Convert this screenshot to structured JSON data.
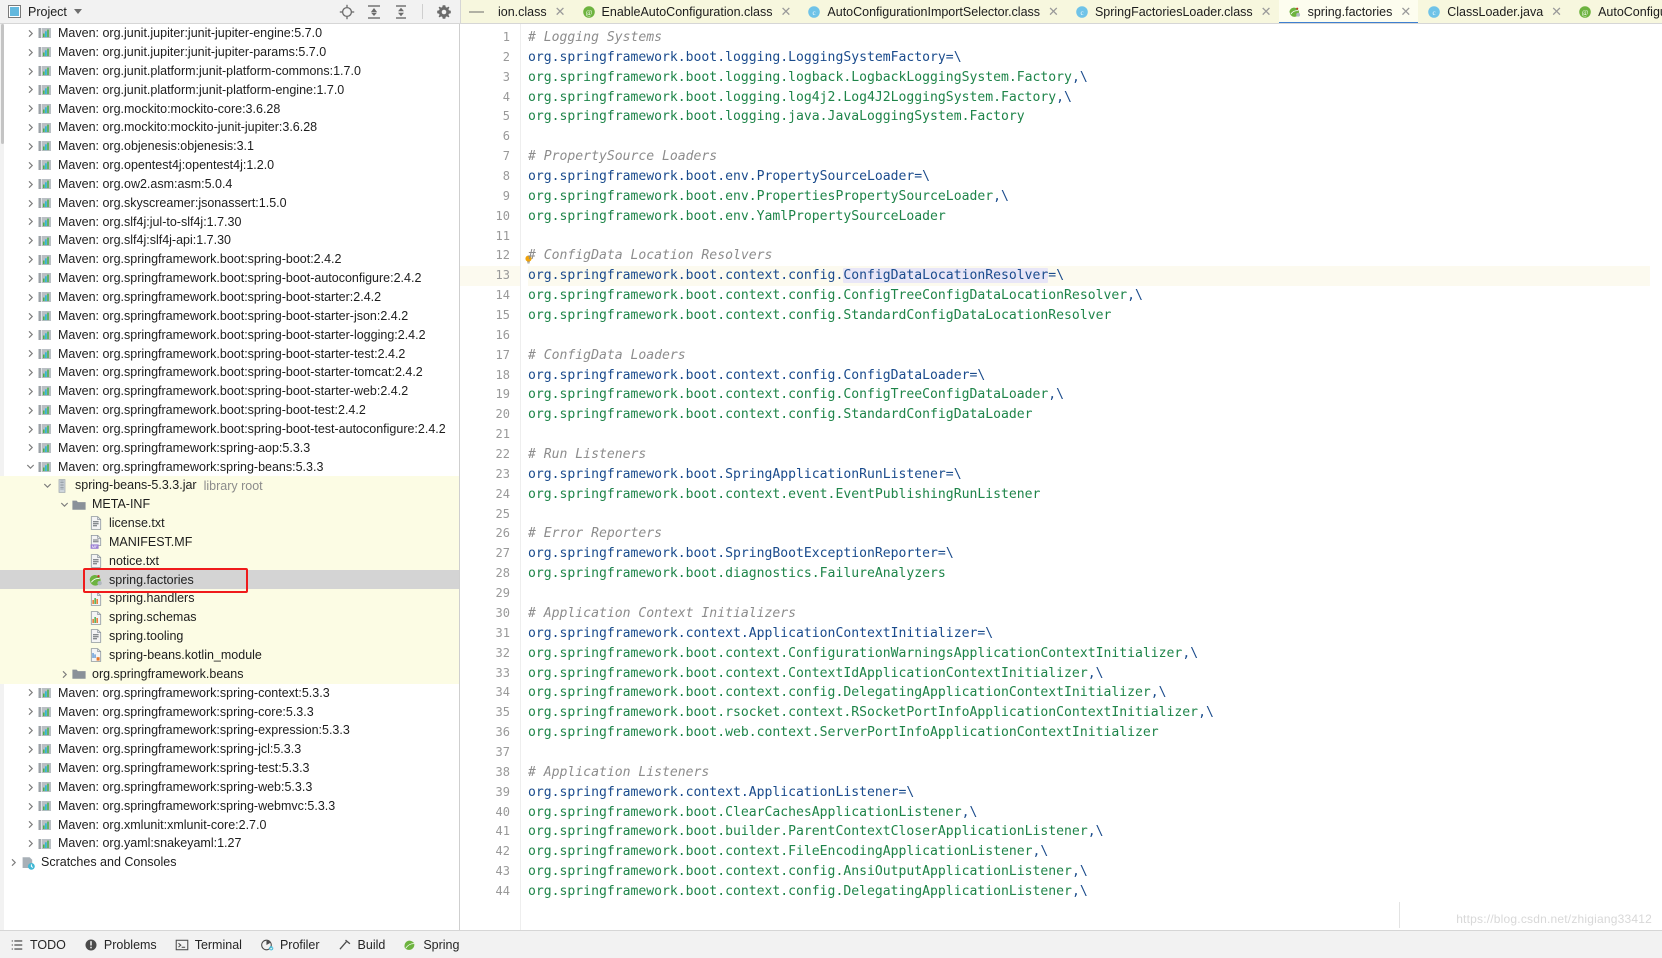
{
  "project_toolbar": {
    "title": "Project",
    "icons": [
      "locate-icon",
      "expand-all-icon",
      "collapse-all-icon",
      "gear-icon"
    ]
  },
  "editor_tabs": {
    "overflow_indicator": "—",
    "tabs": [
      {
        "label": "ion.class",
        "icon": "class-icon",
        "active": false,
        "truncated": true
      },
      {
        "label": "EnableAutoConfiguration.class",
        "icon": "annotation-icon",
        "active": false
      },
      {
        "label": "AutoConfigurationImportSelector.class",
        "icon": "class-icon",
        "active": false
      },
      {
        "label": "SpringFactoriesLoader.class",
        "icon": "class-icon",
        "active": false
      },
      {
        "label": "spring.factories",
        "icon": "spring-icon",
        "active": true
      },
      {
        "label": "ClassLoader.java",
        "icon": "class-icon",
        "active": false
      },
      {
        "label": "AutoConfigu",
        "icon": "annotation-icon",
        "active": false,
        "truncated": true
      }
    ],
    "close_glyph": "✕"
  },
  "tree": {
    "rows": [
      {
        "label": "Maven: org.junit.jupiter:junit-jupiter-engine:5.7.0",
        "icon": "maven-lib-icon",
        "indent": 1,
        "arrow": "collapsed"
      },
      {
        "label": "Maven: org.junit.jupiter:junit-jupiter-params:5.7.0",
        "icon": "maven-lib-icon",
        "indent": 1,
        "arrow": "collapsed"
      },
      {
        "label": "Maven: org.junit.platform:junit-platform-commons:1.7.0",
        "icon": "maven-lib-icon",
        "indent": 1,
        "arrow": "collapsed"
      },
      {
        "label": "Maven: org.junit.platform:junit-platform-engine:1.7.0",
        "icon": "maven-lib-icon",
        "indent": 1,
        "arrow": "collapsed"
      },
      {
        "label": "Maven: org.mockito:mockito-core:3.6.28",
        "icon": "maven-lib-icon",
        "indent": 1,
        "arrow": "collapsed"
      },
      {
        "label": "Maven: org.mockito:mockito-junit-jupiter:3.6.28",
        "icon": "maven-lib-icon",
        "indent": 1,
        "arrow": "collapsed"
      },
      {
        "label": "Maven: org.objenesis:objenesis:3.1",
        "icon": "maven-lib-icon",
        "indent": 1,
        "arrow": "collapsed"
      },
      {
        "label": "Maven: org.opentest4j:opentest4j:1.2.0",
        "icon": "maven-lib-icon",
        "indent": 1,
        "arrow": "collapsed"
      },
      {
        "label": "Maven: org.ow2.asm:asm:5.0.4",
        "icon": "maven-lib-icon",
        "indent": 1,
        "arrow": "collapsed"
      },
      {
        "label": "Maven: org.skyscreamer:jsonassert:1.5.0",
        "icon": "maven-lib-icon",
        "indent": 1,
        "arrow": "collapsed"
      },
      {
        "label": "Maven: org.slf4j:jul-to-slf4j:1.7.30",
        "icon": "maven-lib-icon",
        "indent": 1,
        "arrow": "collapsed"
      },
      {
        "label": "Maven: org.slf4j:slf4j-api:1.7.30",
        "icon": "maven-lib-icon",
        "indent": 1,
        "arrow": "collapsed"
      },
      {
        "label": "Maven: org.springframework.boot:spring-boot:2.4.2",
        "icon": "maven-lib-icon",
        "indent": 1,
        "arrow": "collapsed"
      },
      {
        "label": "Maven: org.springframework.boot:spring-boot-autoconfigure:2.4.2",
        "icon": "maven-lib-icon",
        "indent": 1,
        "arrow": "collapsed"
      },
      {
        "label": "Maven: org.springframework.boot:spring-boot-starter:2.4.2",
        "icon": "maven-lib-icon",
        "indent": 1,
        "arrow": "collapsed"
      },
      {
        "label": "Maven: org.springframework.boot:spring-boot-starter-json:2.4.2",
        "icon": "maven-lib-icon",
        "indent": 1,
        "arrow": "collapsed"
      },
      {
        "label": "Maven: org.springframework.boot:spring-boot-starter-logging:2.4.2",
        "icon": "maven-lib-icon",
        "indent": 1,
        "arrow": "collapsed"
      },
      {
        "label": "Maven: org.springframework.boot:spring-boot-starter-test:2.4.2",
        "icon": "maven-lib-icon",
        "indent": 1,
        "arrow": "collapsed"
      },
      {
        "label": "Maven: org.springframework.boot:spring-boot-starter-tomcat:2.4.2",
        "icon": "maven-lib-icon",
        "indent": 1,
        "arrow": "collapsed"
      },
      {
        "label": "Maven: org.springframework.boot:spring-boot-starter-web:2.4.2",
        "icon": "maven-lib-icon",
        "indent": 1,
        "arrow": "collapsed"
      },
      {
        "label": "Maven: org.springframework.boot:spring-boot-test:2.4.2",
        "icon": "maven-lib-icon",
        "indent": 1,
        "arrow": "collapsed"
      },
      {
        "label": "Maven: org.springframework.boot:spring-boot-test-autoconfigure:2.4.2",
        "icon": "maven-lib-icon",
        "indent": 1,
        "arrow": "collapsed"
      },
      {
        "label": "Maven: org.springframework:spring-aop:5.3.3",
        "icon": "maven-lib-icon",
        "indent": 1,
        "arrow": "collapsed"
      },
      {
        "label": "Maven: org.springframework:spring-beans:5.3.3",
        "icon": "maven-lib-icon",
        "indent": 1,
        "arrow": "expanded"
      },
      {
        "label": "spring-beans-5.3.3.jar",
        "suffix": "library root",
        "icon": "jar-icon",
        "indent": 2,
        "arrow": "expanded",
        "lib": true
      },
      {
        "label": "META-INF",
        "icon": "folder-icon",
        "indent": 3,
        "arrow": "expanded",
        "lib": true
      },
      {
        "label": "license.txt",
        "icon": "text-file-icon",
        "indent": 4,
        "arrow": "none",
        "lib": true
      },
      {
        "label": "MANIFEST.MF",
        "icon": "manifest-icon",
        "indent": 4,
        "arrow": "none",
        "lib": true
      },
      {
        "label": "notice.txt",
        "icon": "text-file-icon",
        "indent": 4,
        "arrow": "none",
        "lib": true
      },
      {
        "label": "spring.factories",
        "icon": "spring-icon",
        "indent": 4,
        "arrow": "none",
        "selected": true,
        "highlighted": true
      },
      {
        "label": "spring.handlers",
        "icon": "properties-icon",
        "indent": 4,
        "arrow": "none",
        "lib": true
      },
      {
        "label": "spring.schemas",
        "icon": "properties-icon",
        "indent": 4,
        "arrow": "none",
        "lib": true
      },
      {
        "label": "spring.tooling",
        "icon": "text-file-icon",
        "indent": 4,
        "arrow": "none",
        "lib": true
      },
      {
        "label": "spring-beans.kotlin_module",
        "icon": "kotlin-module-icon",
        "indent": 4,
        "arrow": "none",
        "lib": true
      },
      {
        "label": "org.springframework.beans",
        "icon": "folder-icon",
        "indent": 3,
        "arrow": "collapsed",
        "lib": true
      },
      {
        "label": "Maven: org.springframework:spring-context:5.3.3",
        "icon": "maven-lib-icon",
        "indent": 1,
        "arrow": "collapsed"
      },
      {
        "label": "Maven: org.springframework:spring-core:5.3.3",
        "icon": "maven-lib-icon",
        "indent": 1,
        "arrow": "collapsed"
      },
      {
        "label": "Maven: org.springframework:spring-expression:5.3.3",
        "icon": "maven-lib-icon",
        "indent": 1,
        "arrow": "collapsed"
      },
      {
        "label": "Maven: org.springframework:spring-jcl:5.3.3",
        "icon": "maven-lib-icon",
        "indent": 1,
        "arrow": "collapsed"
      },
      {
        "label": "Maven: org.springframework:spring-test:5.3.3",
        "icon": "maven-lib-icon",
        "indent": 1,
        "arrow": "collapsed"
      },
      {
        "label": "Maven: org.springframework:spring-web:5.3.3",
        "icon": "maven-lib-icon",
        "indent": 1,
        "arrow": "collapsed"
      },
      {
        "label": "Maven: org.springframework:spring-webmvc:5.3.3",
        "icon": "maven-lib-icon",
        "indent": 1,
        "arrow": "collapsed"
      },
      {
        "label": "Maven: org.xmlunit:xmlunit-core:2.7.0",
        "icon": "maven-lib-icon",
        "indent": 1,
        "arrow": "collapsed"
      },
      {
        "label": "Maven: org.yaml:snakeyaml:1.27",
        "icon": "maven-lib-icon",
        "indent": 1,
        "arrow": "collapsed"
      },
      {
        "label": "Scratches and Consoles",
        "icon": "scratches-icon",
        "indent": 0,
        "arrow": "collapsed"
      }
    ]
  },
  "editor": {
    "file": "spring.factories",
    "current_line": 13,
    "bulb_line": 12,
    "highlight_token": "ConfigDataLocationResolver",
    "lines": [
      {
        "n": 1,
        "type": "comment",
        "text": "# Logging Systems"
      },
      {
        "n": 2,
        "type": "key",
        "text": "org.springframework.boot.logging.LoggingSystemFactory=\\"
      },
      {
        "n": 3,
        "type": "value",
        "text": "org.springframework.boot.logging.logback.LogbackLoggingSystem.Factory,\\"
      },
      {
        "n": 4,
        "type": "value",
        "text": "org.springframework.boot.logging.log4j2.Log4J2LoggingSystem.Factory,\\"
      },
      {
        "n": 5,
        "type": "value",
        "text": "org.springframework.boot.logging.java.JavaLoggingSystem.Factory"
      },
      {
        "n": 6,
        "type": "blank",
        "text": ""
      },
      {
        "n": 7,
        "type": "comment",
        "text": "# PropertySource Loaders"
      },
      {
        "n": 8,
        "type": "key",
        "text": "org.springframework.boot.env.PropertySourceLoader=\\"
      },
      {
        "n": 9,
        "type": "value",
        "text": "org.springframework.boot.env.PropertiesPropertySourceLoader,\\"
      },
      {
        "n": 10,
        "type": "value",
        "text": "org.springframework.boot.env.YamlPropertySourceLoader"
      },
      {
        "n": 11,
        "type": "blank",
        "text": ""
      },
      {
        "n": 12,
        "type": "comment",
        "text": "# ConfigData Location Resolvers"
      },
      {
        "n": 13,
        "type": "key",
        "text": "org.springframework.boot.context.config.ConfigDataLocationResolver=\\"
      },
      {
        "n": 14,
        "type": "value",
        "text": "org.springframework.boot.context.config.ConfigTreeConfigDataLocationResolver,\\"
      },
      {
        "n": 15,
        "type": "value",
        "text": "org.springframework.boot.context.config.StandardConfigDataLocationResolver"
      },
      {
        "n": 16,
        "type": "blank",
        "text": ""
      },
      {
        "n": 17,
        "type": "comment",
        "text": "# ConfigData Loaders"
      },
      {
        "n": 18,
        "type": "key",
        "text": "org.springframework.boot.context.config.ConfigDataLoader=\\"
      },
      {
        "n": 19,
        "type": "value",
        "text": "org.springframework.boot.context.config.ConfigTreeConfigDataLoader,\\"
      },
      {
        "n": 20,
        "type": "value",
        "text": "org.springframework.boot.context.config.StandardConfigDataLoader"
      },
      {
        "n": 21,
        "type": "blank",
        "text": ""
      },
      {
        "n": 22,
        "type": "comment",
        "text": "# Run Listeners"
      },
      {
        "n": 23,
        "type": "key",
        "text": "org.springframework.boot.SpringApplicationRunListener=\\"
      },
      {
        "n": 24,
        "type": "value",
        "text": "org.springframework.boot.context.event.EventPublishingRunListener"
      },
      {
        "n": 25,
        "type": "blank",
        "text": ""
      },
      {
        "n": 26,
        "type": "comment",
        "text": "# Error Reporters"
      },
      {
        "n": 27,
        "type": "key",
        "text": "org.springframework.boot.SpringBootExceptionReporter=\\"
      },
      {
        "n": 28,
        "type": "value",
        "text": "org.springframework.boot.diagnostics.FailureAnalyzers"
      },
      {
        "n": 29,
        "type": "blank",
        "text": ""
      },
      {
        "n": 30,
        "type": "comment",
        "text": "# Application Context Initializers"
      },
      {
        "n": 31,
        "type": "key",
        "text": "org.springframework.context.ApplicationContextInitializer=\\"
      },
      {
        "n": 32,
        "type": "value",
        "text": "org.springframework.boot.context.ConfigurationWarningsApplicationContextInitializer,\\"
      },
      {
        "n": 33,
        "type": "value",
        "text": "org.springframework.boot.context.ContextIdApplicationContextInitializer,\\"
      },
      {
        "n": 34,
        "type": "value",
        "text": "org.springframework.boot.context.config.DelegatingApplicationContextInitializer,\\"
      },
      {
        "n": 35,
        "type": "value",
        "text": "org.springframework.boot.rsocket.context.RSocketPortInfoApplicationContextInitializer,\\"
      },
      {
        "n": 36,
        "type": "value",
        "text": "org.springframework.boot.web.context.ServerPortInfoApplicationContextInitializer"
      },
      {
        "n": 37,
        "type": "blank",
        "text": ""
      },
      {
        "n": 38,
        "type": "comment",
        "text": "# Application Listeners"
      },
      {
        "n": 39,
        "type": "key",
        "text": "org.springframework.context.ApplicationListener=\\"
      },
      {
        "n": 40,
        "type": "value",
        "text": "org.springframework.boot.ClearCachesApplicationListener,\\"
      },
      {
        "n": 41,
        "type": "value",
        "text": "org.springframework.boot.builder.ParentContextCloserApplicationListener,\\"
      },
      {
        "n": 42,
        "type": "value",
        "text": "org.springframework.boot.context.FileEncodingApplicationListener,\\"
      },
      {
        "n": 43,
        "type": "value",
        "text": "org.springframework.boot.context.config.AnsiOutputApplicationListener,\\"
      },
      {
        "n": 44,
        "type": "value",
        "text": "org.springframework.boot.context.config.DelegatingApplicationListener,\\"
      }
    ]
  },
  "statusbar": {
    "items": [
      {
        "label": "TODO",
        "icon": "todo-icon"
      },
      {
        "label": "Problems",
        "icon": "problems-icon"
      },
      {
        "label": "Terminal",
        "icon": "terminal-icon"
      },
      {
        "label": "Profiler",
        "icon": "profiler-icon"
      },
      {
        "label": "Build",
        "icon": "build-hammer-icon"
      },
      {
        "label": "Spring",
        "icon": "spring-leaf-icon"
      }
    ]
  },
  "watermark": {
    "text": "https://blog.csdn.net/zhigiang33412"
  },
  "colors": {
    "tab_strip_bg": "#f7f7de",
    "active_tab_underline": "#3e7fd0",
    "library_row_bg": "#fcfce4",
    "selected_row_bg": "#d4d4d4",
    "highlight_box": "#ef1b1b",
    "comment": "#8c8c8c",
    "key": "#1a4b8c",
    "value": "#1e8449",
    "current_line_bg": "#fcfaef"
  }
}
